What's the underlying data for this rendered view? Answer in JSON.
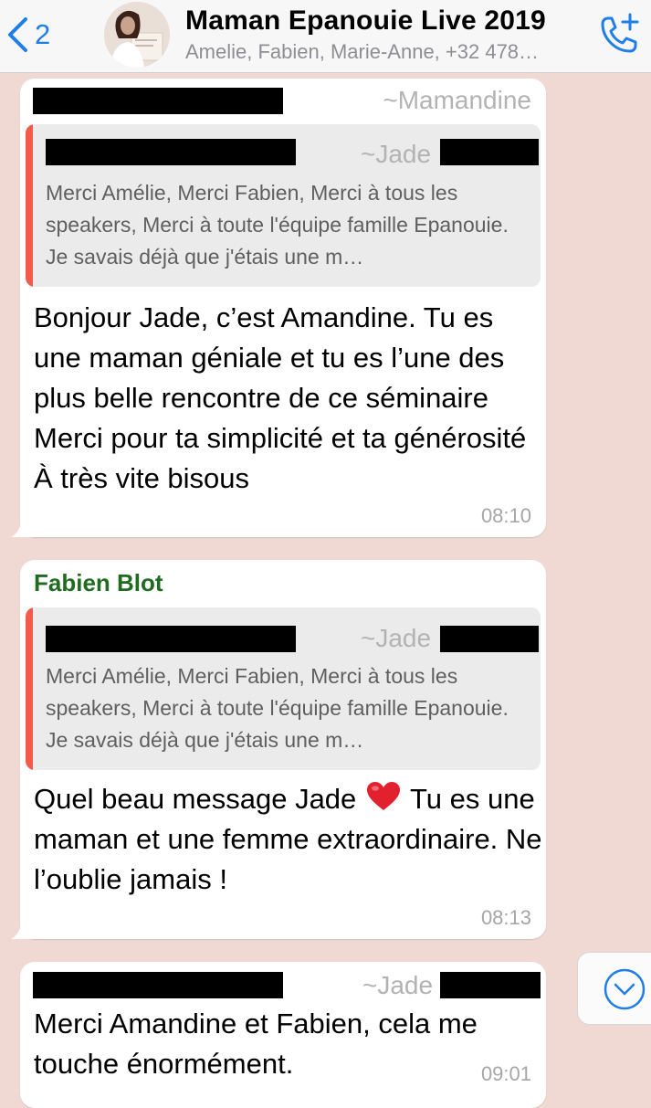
{
  "header": {
    "back_count": "2",
    "title": "Maman Epanouie Live 2019",
    "subtitle": "Amelie, Fabien, Marie-Anne, +32 478…",
    "avatar": "group-avatar",
    "call_icon": "add-call-icon",
    "accent_color": "#1f7ee8"
  },
  "messages": [
    {
      "sender_handle": "~Mamandine",
      "quote_author": "~Jade",
      "quote_text": "Merci Amélie, Merci Fabien, Merci à tous les speakers, Merci à toute l'équipe famille Epanouie. Je savais déjà que j'étais une m…",
      "text": "Bonjour Jade, c’est Amandine. Tu es une maman géniale et tu es l’une des plus belle rencontre de ce séminaire Merci pour ta simplicité et ta générosité À très vite bisous",
      "time": "08:10"
    },
    {
      "sender_name": "Fabien Blot",
      "sender_color": "#1f6b1f",
      "quote_author": "~Jade",
      "quote_text": "Merci Amélie, Merci Fabien, Merci à tous les speakers, Merci à toute l'équipe famille Epanouie. Je savais déjà que j'étais une m…",
      "text_before_emoji": "Quel beau message Jade",
      "emoji": "red-heart-emoji",
      "text_after_emoji": "Tu es une maman et une femme extraordinaire. Ne l’oublie jamais !",
      "time": "08:13"
    },
    {
      "sender_handle": "~Jade",
      "text": "Merci Amandine et Fabien, cela me touche énormément.",
      "time": "09:01"
    }
  ],
  "scroll_button": {
    "icon": "chevron-down-circle-icon"
  },
  "colors": {
    "background": "#efd9d2",
    "quote_bar": "#f45a49",
    "bubble": "#ffffff"
  }
}
